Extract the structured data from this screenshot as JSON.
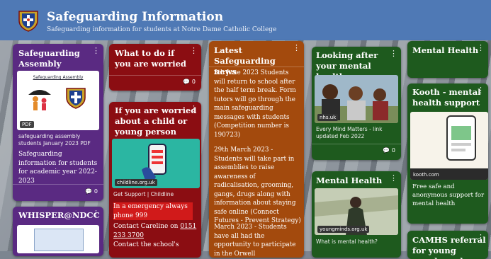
{
  "header": {
    "title": "Safeguarding Information",
    "subtitle": "Safeguarding information for students at Notre Dame Catholic College"
  },
  "colors": {
    "header": "#4f79b5",
    "purple": "#5a2a82",
    "maroon": "#8b0d12",
    "orange": "#a34a0d",
    "green": "#1e5a1e"
  },
  "cards": {
    "assembly": {
      "title": "Safeguarding Assembly",
      "thumb_heading": "Safeguarding Assembly",
      "badge": "PDF",
      "caption": "safeguarding assembly students January 2023 PDF",
      "body": "Safeguarding information for students for academic year 2022- 2023",
      "comments": "0"
    },
    "whisper": {
      "title": "WHISPER@NDCC"
    },
    "worried": {
      "title": "What to do if you are worried",
      "comments": "0"
    },
    "child": {
      "title": "If you are worried about a child or young person",
      "link_label": "childline.org.uk",
      "caption": "Get Support | Childline",
      "emergency": "In a emergency always phone 999",
      "contact_prefix": "Contact Careline on",
      "phone": "0151 233 3700",
      "contact_school": "Contact the school's"
    },
    "latest": {
      "title": "Latest Safeguarding news",
      "para1": "5th June 2023 Students will return to school after the half term break. Form tutors will go through the main safeguarding messages with students (Competition number is 190723)",
      "para2": "29th March 2023 - Students will take part in assemblies to raise awareness of radicalisation, grooming, gangs, drugs along with information about staying safe online (Connect Futures - Prevent Strategy)",
      "para3": "March 2023 - Students have all had the opportunity to participate in the Orwell"
    },
    "looking": {
      "title": "Looking after your mental health",
      "site": "nhs.uk",
      "caption": "Every Mind Matters - link updated Feb 2022",
      "comments": "0"
    },
    "mh1": {
      "title": "Mental Health",
      "site": "youngminds.org.uk",
      "caption": "What is mental health?"
    },
    "mh2": {
      "title": "Mental Health"
    },
    "kooth": {
      "title": "Kooth - mental health support",
      "site": "kooth.com",
      "body": "Free safe and anonymous support for mental health"
    },
    "camhs": {
      "title": "CAMHS referral for young people under"
    }
  }
}
